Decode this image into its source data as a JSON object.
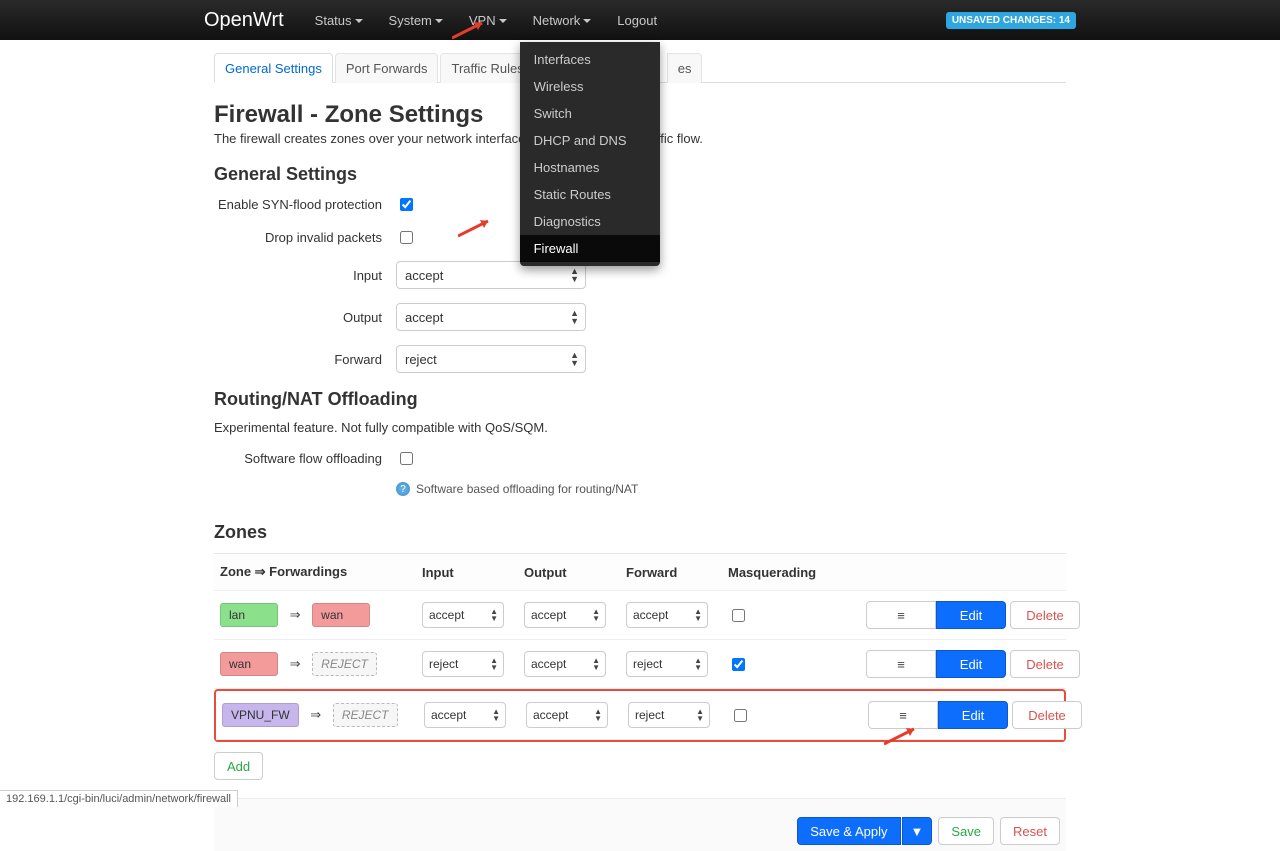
{
  "brand": "OpenWrt",
  "nav": {
    "status": "Status",
    "system": "System",
    "vpn": "VPN",
    "network": "Network",
    "logout": "Logout"
  },
  "unsaved": "UNSAVED CHANGES: 14",
  "network_menu": {
    "interfaces": "Interfaces",
    "wireless": "Wireless",
    "switch": "Switch",
    "dhcp": "DHCP and DNS",
    "hostnames": "Hostnames",
    "static_routes": "Static Routes",
    "diagnostics": "Diagnostics",
    "firewall": "Firewall"
  },
  "tabs": {
    "general": "General Settings",
    "port_forwards": "Port Forwards",
    "traffic_rules": "Traffic Rules",
    "custom_rules": "es"
  },
  "page": {
    "title": "Firewall - Zone Settings",
    "desc": "The firewall creates zones over your network interfaces to control network traffic flow."
  },
  "gen": {
    "heading": "General Settings",
    "syn_label": "Enable SYN-flood protection",
    "drop_label": "Drop invalid packets",
    "input_label": "Input",
    "input_value": "accept",
    "output_label": "Output",
    "output_value": "accept",
    "forward_label": "Forward",
    "forward_value": "reject"
  },
  "offload": {
    "heading": "Routing/NAT Offloading",
    "desc": "Experimental feature. Not fully compatible with QoS/SQM.",
    "sw_label": "Software flow offloading",
    "help": "Software based offloading for routing/NAT"
  },
  "zones": {
    "heading": "Zones",
    "col_zone": "Zone ⇒ Forwardings",
    "col_input": "Input",
    "col_output": "Output",
    "col_forward": "Forward",
    "col_masq": "Masquerading",
    "rows": [
      {
        "src": "lan",
        "src_class": "lan",
        "dst": "wan",
        "dst_class": "wan",
        "input": "accept",
        "output": "accept",
        "forward": "accept",
        "masq": false
      },
      {
        "src": "wan",
        "src_class": "wan",
        "dst": "REJECT",
        "dst_class": "reject",
        "input": "reject",
        "output": "accept",
        "forward": "reject",
        "masq": true
      },
      {
        "src": "VPNU_FW",
        "src_class": "vpn",
        "dst": "REJECT",
        "dst_class": "reject",
        "input": "accept",
        "output": "accept",
        "forward": "reject",
        "masq": false
      }
    ],
    "edit": "Edit",
    "delete": "Delete",
    "add": "Add"
  },
  "page_actions": {
    "save_apply": "Save & Apply",
    "save": "Save",
    "reset": "Reset"
  },
  "status_url": "192.169.1.1/cgi-bin/luci/admin/network/firewall"
}
